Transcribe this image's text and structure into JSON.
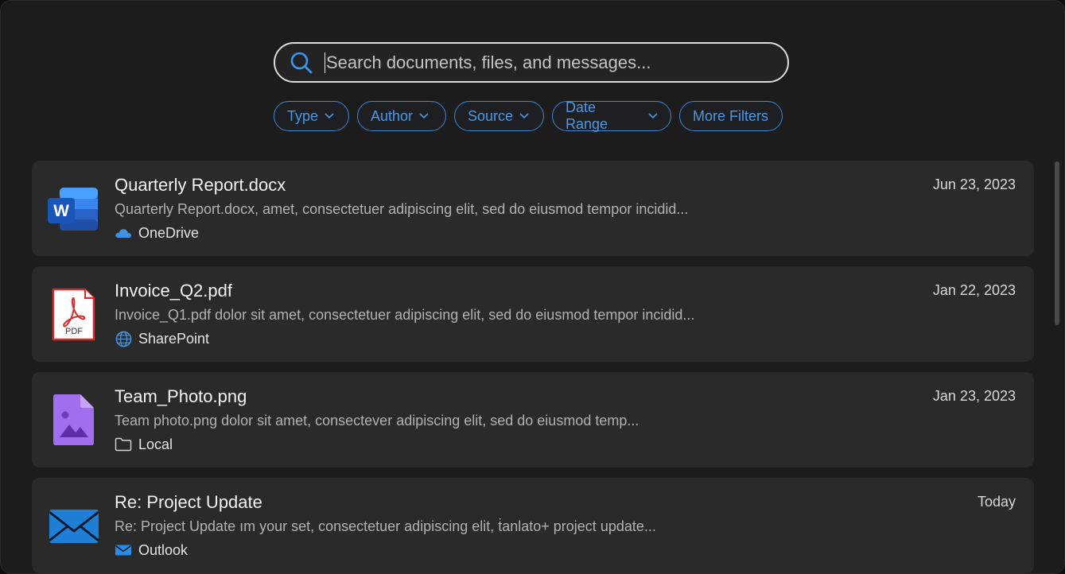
{
  "search": {
    "placeholder": "Search documents, files, and messages..."
  },
  "filters": [
    {
      "label": "Type",
      "dropdown": true
    },
    {
      "label": "Author",
      "dropdown": true
    },
    {
      "label": "Source",
      "dropdown": true
    },
    {
      "label": "Date Range",
      "dropdown": true
    },
    {
      "label": "More Filters",
      "dropdown": false
    }
  ],
  "results": [
    {
      "icon": "word-document-icon",
      "title": "Quarterly Report.docx",
      "snippet": "Quarterly Report.docx, amet, consectetuer adipiscing elit, sed do eiusmod tempor incidid...",
      "source": "OneDrive",
      "source_icon": "onedrive-cloud-icon",
      "date": "Jun 23, 2023"
    },
    {
      "icon": "pdf-document-icon",
      "title": "Invoice_Q2.pdf",
      "snippet": "Invoice_Q1.pdf dolor sit amet, consectetuer adipiscing elit, sed do eiusmod tempor incidid...",
      "source": "SharePoint",
      "source_icon": "globe-icon",
      "date": "Jan 22, 2023"
    },
    {
      "icon": "image-file-icon",
      "title": "Team_Photo.png",
      "snippet": "Team photo.png dolor sit amet, consectever adipiscing elit, sed do eiusmod temp...",
      "source": "Local",
      "source_icon": "folder-icon",
      "date": "Jan 23, 2023"
    },
    {
      "icon": "email-envelope-icon",
      "title": "Re: Project Update",
      "snippet": "Re: Project Update ım your set, consectetuer adipiscing elit, ṫanlato+ project update...",
      "source": "Outlook",
      "source_icon": "outlook-mail-icon",
      "date": "Today"
    }
  ],
  "colors": {
    "accent": "#3b86d6",
    "background": "#1c1c1c",
    "card": "#2a2a2a"
  }
}
